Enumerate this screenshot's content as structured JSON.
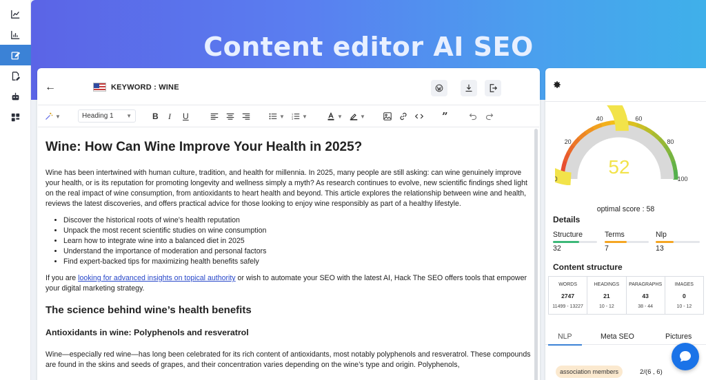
{
  "rail": {
    "items": [
      {
        "icon": "line-chart-icon",
        "active": false
      },
      {
        "icon": "bar-chart-icon",
        "active": false
      },
      {
        "icon": "edit-icon",
        "active": true
      },
      {
        "icon": "document-edit-icon",
        "active": false
      },
      {
        "icon": "robot-icon",
        "active": false
      },
      {
        "icon": "dashboard-icon",
        "active": false
      }
    ]
  },
  "hero": {
    "title": "Content editor AI SEO"
  },
  "editor": {
    "keyword_label": "KEYWORD : WINE",
    "toolbar": {
      "heading_select": "Heading 1"
    },
    "content": {
      "h1": "Wine: How Can Wine Improve Your Health in 2025?",
      "intro": "Wine has been intertwined with human culture, tradition, and health for millennia. In 2025, many people are still asking: can wine genuinely improve your health, or is its reputation for promoting longevity and wellness simply a myth? As research continues to evolve, new scientific findings shed light on the real impact of wine consumption, from antioxidants to heart health and beyond. This article explores the relationship between wine and health, reviews the latest discoveries, and offers practical advice for those looking to enjoy wine responsibly as part of a healthy lifestyle.",
      "bullets": [
        "Discover the historical roots of wine’s health reputation",
        "Unpack the most recent scientific studies on wine consumption",
        "Learn how to integrate wine into a balanced diet in 2025",
        "Understand the importance of moderation and personal factors",
        "Find expert-backed tips for maximizing health benefits safely"
      ],
      "cta_before": "If you are ",
      "cta_link": "looking for advanced insights on topical authority",
      "cta_after": " or wish to automate your SEO with the latest AI, Hack The SEO offers tools that empower your digital marketing strategy.",
      "h2": "The science behind wine’s health benefits",
      "h3": "Antioxidants in wine: Polyphenols and resveratrol",
      "para2": "Wine—especially red wine—has long been celebrated for its rich content of antioxidants, most notably polyphenols and resveratrol. These compounds are found in the skins and seeds of grapes, and their concentration varies depending on the wine’s type and origin. Polyphenols,"
    }
  },
  "panel": {
    "gauge": {
      "score": 52,
      "score_fraction": 0.52,
      "tick_labels": [
        "0",
        "20",
        "40",
        "60",
        "80",
        "100"
      ],
      "colors": {
        "score": "#f2e34a",
        "track": "#d9d9d9",
        "ring_low": "#e53935",
        "ring_mid": "#f5c518",
        "ring_high": "#4caf50"
      }
    },
    "optimal_label": "optimal score : 58",
    "details_title": "Details",
    "metrics": [
      {
        "label": "Structure",
        "value": "32",
        "fill": 0.6,
        "color": "#3cb878"
      },
      {
        "label": "Terms",
        "value": "7",
        "fill": 0.5,
        "color": "#f5a623"
      },
      {
        "label": "Nlp",
        "value": "13",
        "fill": 0.4,
        "color": "#f5a623"
      }
    ],
    "content_structure_title": "Content structure",
    "structure": [
      {
        "header": "WORDS",
        "value": "2747",
        "range": "11499 - 13227"
      },
      {
        "header": "HEADINGS",
        "value": "21",
        "range": "10 - 12"
      },
      {
        "header": "PARAGRAPHS",
        "value": "43",
        "range": "38 - 44"
      },
      {
        "header": "IMAGES",
        "value": "0",
        "range": "10 - 12"
      }
    ],
    "tabs": [
      "NLP",
      "Meta SEO",
      "Pictures"
    ],
    "active_tab": "NLP",
    "nlp_term": "association members",
    "nlp_term_count": "2/(6 , 6)"
  }
}
